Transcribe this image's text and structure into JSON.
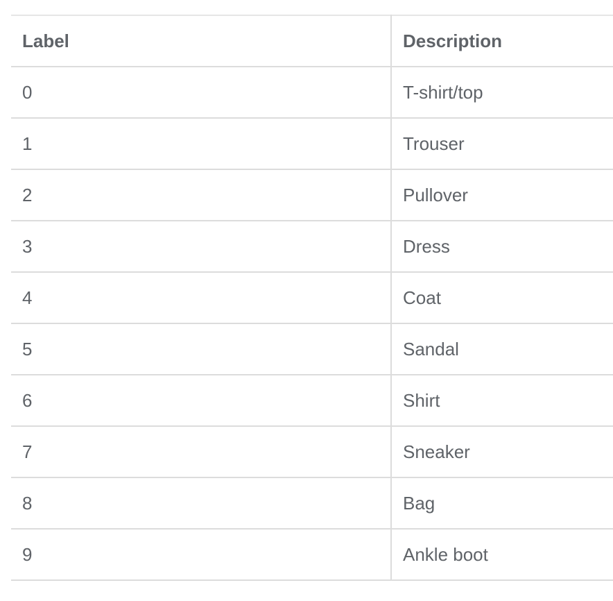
{
  "table": {
    "headers": [
      "Label",
      "Description"
    ],
    "rows": [
      [
        "0",
        "T-shirt/top"
      ],
      [
        "1",
        "Trouser"
      ],
      [
        "2",
        "Pullover"
      ],
      [
        "3",
        "Dress"
      ],
      [
        "4",
        "Coat"
      ],
      [
        "5",
        "Sandal"
      ],
      [
        "6",
        "Shirt"
      ],
      [
        "7",
        "Sneaker"
      ],
      [
        "8",
        "Bag"
      ],
      [
        "9",
        "Ankle boot"
      ]
    ]
  }
}
